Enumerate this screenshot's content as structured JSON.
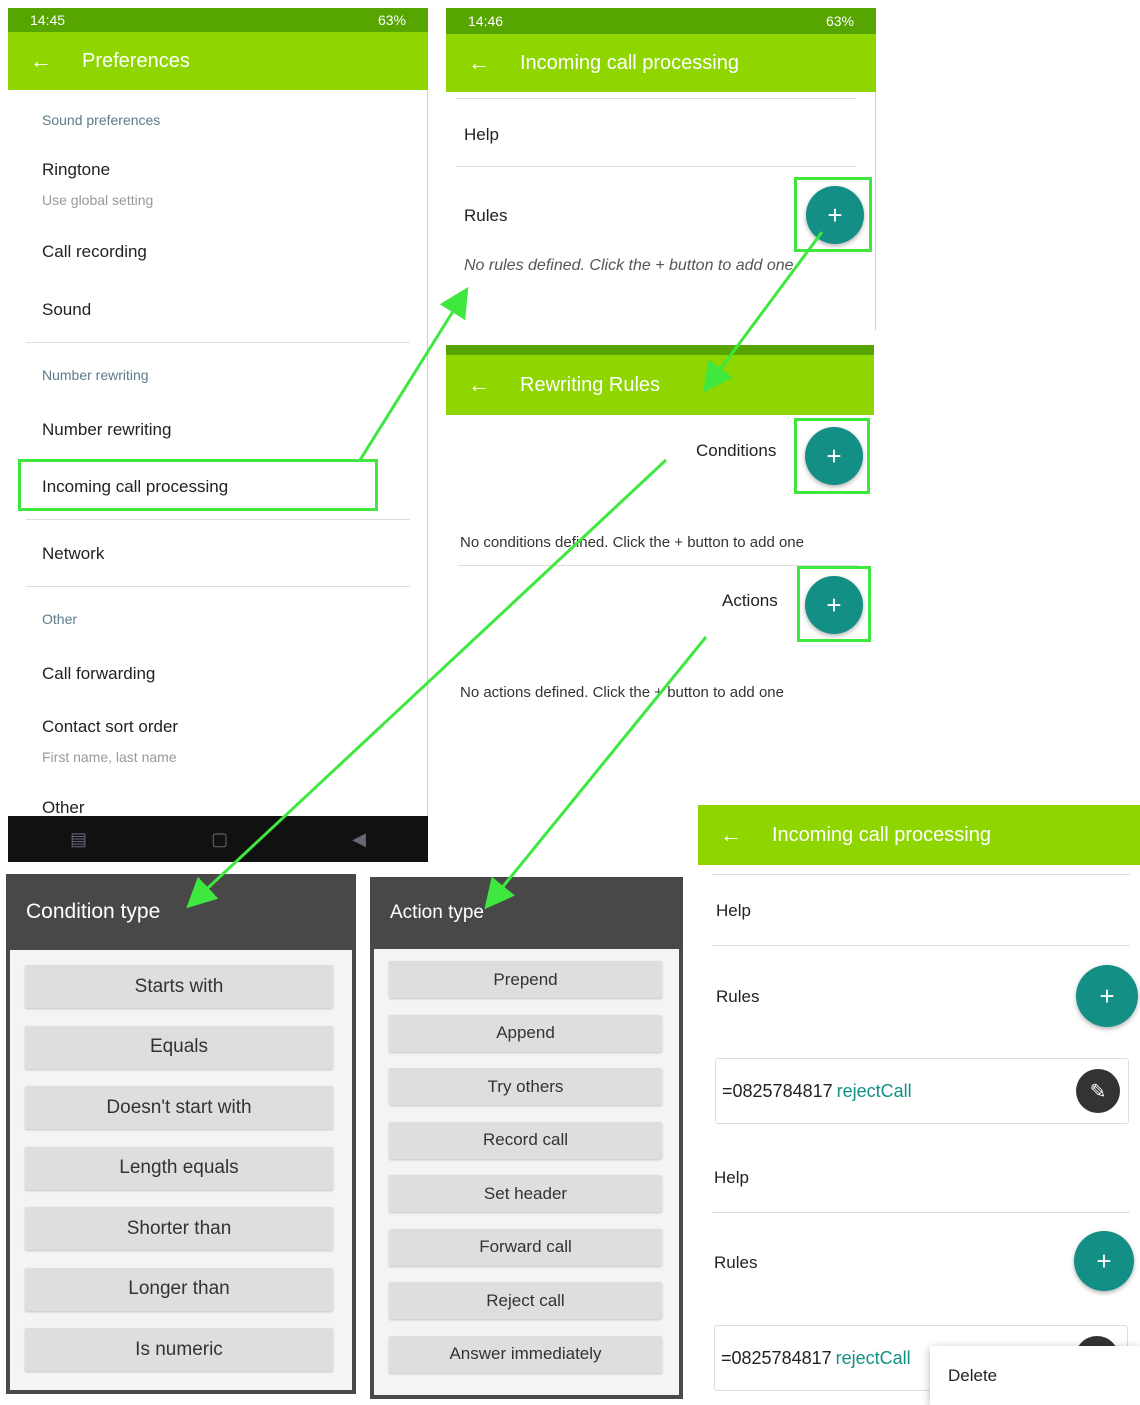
{
  "colors": {
    "accent": "#8fd500",
    "fab": "#138f85",
    "highlight": "#3ee83e",
    "dialog_title": "#484848"
  },
  "prefs": {
    "status_time": "14:45",
    "status_right": "63%",
    "title": "Preferences",
    "sections": {
      "sound": "Sound preferences",
      "number": "Number rewriting",
      "other": "Other"
    },
    "items": {
      "ringtone": "Ringtone",
      "ringtone_sub": "Use global setting",
      "call_recording": "Call recording",
      "sound": "Sound",
      "number_rewriting": "Number rewriting",
      "incoming": "Incoming call processing",
      "network": "Network",
      "call_forwarding": "Call forwarding",
      "contact_sort": "Contact sort order",
      "contact_sort_sub": "First name, last name",
      "other": "Other"
    }
  },
  "incoming1": {
    "status_time": "14:46",
    "status_right": "63%",
    "title": "Incoming call processing",
    "help": "Help",
    "rules": "Rules",
    "empty": "No rules defined. Click the + button to add one"
  },
  "rewriting": {
    "title": "Rewriting Rules",
    "conditions": "Conditions",
    "conditions_empty": "No conditions defined. Click the + button to add one",
    "actions": "Actions",
    "actions_empty": "No actions defined. Click the + button to add one"
  },
  "condition_dialog": {
    "title": "Condition type",
    "options": [
      "Starts with",
      "Equals",
      "Doesn't start with",
      "Length equals",
      "Shorter than",
      "Longer than",
      "Is numeric"
    ]
  },
  "action_dialog": {
    "title": "Action type",
    "options": [
      "Prepend",
      "Append",
      "Try others",
      "Record call",
      "Set header",
      "Forward call",
      "Reject call",
      "Answer immediately"
    ]
  },
  "incoming2": {
    "title": "Incoming call processing",
    "help": "Help",
    "rules": "Rules",
    "rule_number": "=0825784817",
    "rule_action": "rejectCall",
    "help2": "Help",
    "rules2": "Rules",
    "rule_number2": "=0825784817",
    "rule_action2": "rejectCall",
    "menu_delete": "Delete"
  }
}
